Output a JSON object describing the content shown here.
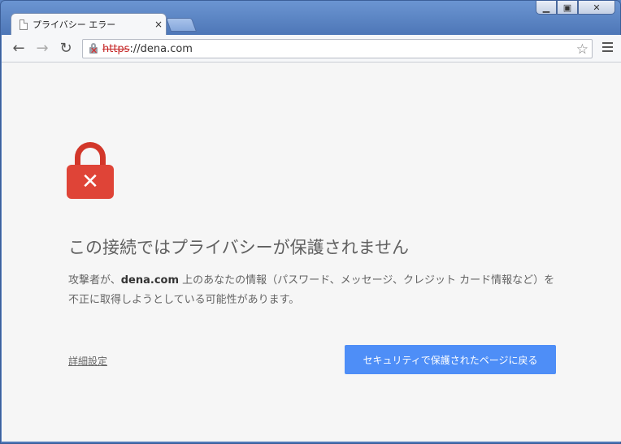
{
  "window": {
    "minimize_glyph": "▁",
    "maximize_glyph": "▣",
    "close_glyph": "✕"
  },
  "tab": {
    "title": "プライバシー エラー",
    "close_glyph": "×",
    "icon": "page-icon"
  },
  "toolbar": {
    "back_glyph": "←",
    "forward_glyph": "→",
    "reload_glyph": "↻",
    "url_scheme": "https",
    "url_rest": "://dena.com",
    "star_glyph": "☆"
  },
  "main": {
    "lock_glyph": "✕",
    "heading": "この接続ではプライバシーが保護されません",
    "desc_before": "攻撃者が、",
    "desc_domain": "dena.com",
    "desc_after": " 上のあなたの情報（パスワード、メッセージ、クレジット カード情報など）を不正に取得しようとしている可能性があります。",
    "advanced_link": "詳細設定",
    "back_button": "セキュリティで保護されたページに戻る"
  },
  "colors": {
    "accent_button": "#4e8ef7",
    "lock_red": "#df4437",
    "window_blue": "#5a84c4"
  }
}
